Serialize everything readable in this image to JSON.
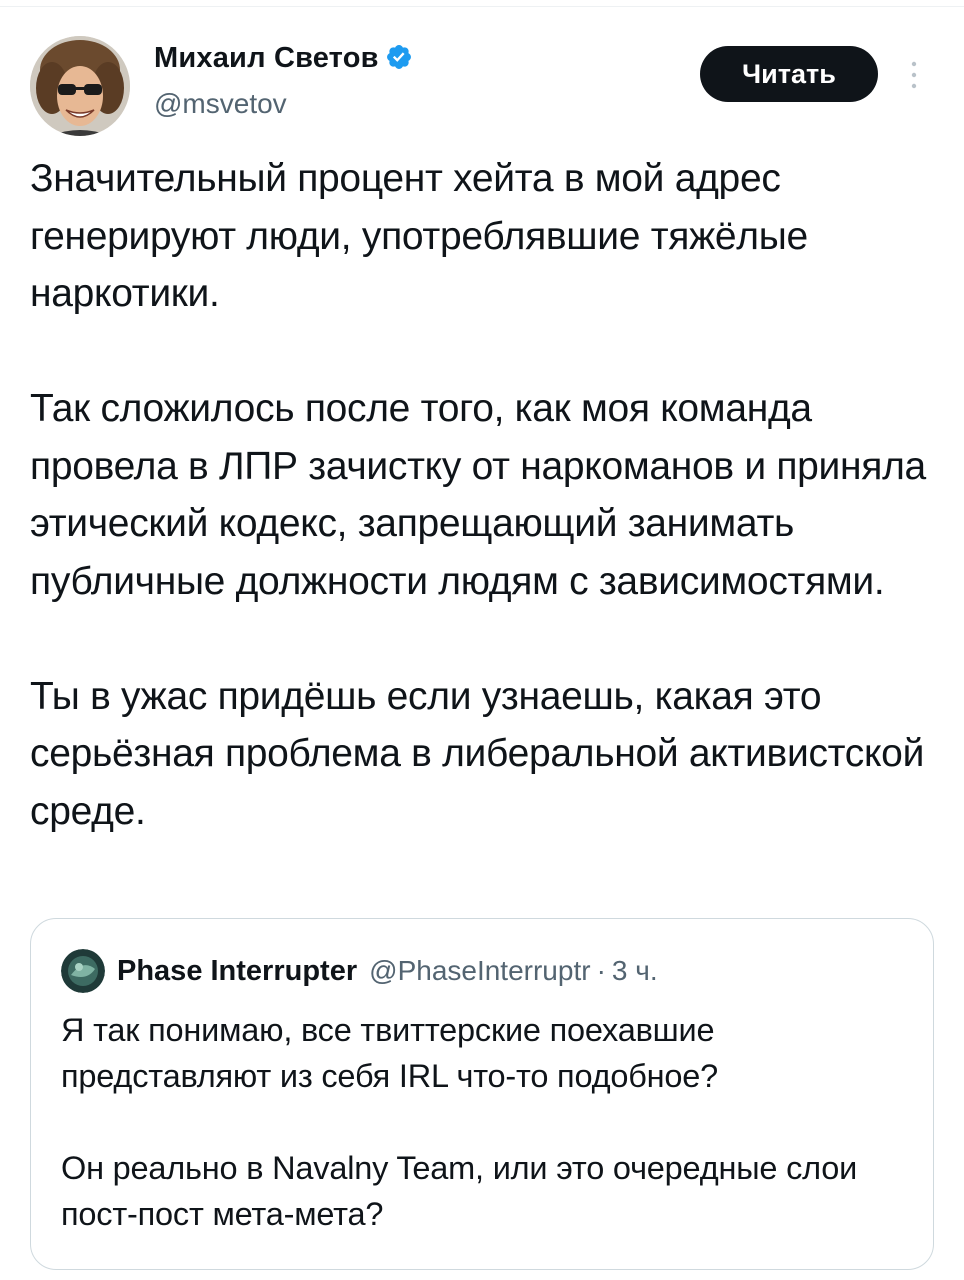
{
  "tweet": {
    "author": {
      "name": "Михаил Светов",
      "handle": "@msvetov",
      "verified": true
    },
    "follow_button_label": "Читать",
    "text": "Значительный процент хейта в мой адрес генерируют люди, употреблявшие тяжёлые наркотики.\n\nТак сложилось после того, как моя команда провела в ЛПР зачистку от наркоманов и приняла этический кодекс, запрещающий занимать публичные должности людям с зависимостями.\n\nТы в ужас придёшь если узнаешь, какая это серьёзная проблема в либеральной активистской среде."
  },
  "quote": {
    "author": {
      "name": "Phase Interrupter",
      "handle": "@PhaseInterruptr"
    },
    "separator": "·",
    "time": "3 ч.",
    "text": "Я так понимаю, все твиттерские поехавшие представляют из себя IRL что-то подобное?\n\nОн реально в Navalny Team, или это очередные слои пост-пост мета-мета?"
  },
  "icons": {
    "verified": "verified-badge-icon",
    "more": "more-vertical-icon"
  },
  "colors": {
    "verified": "#1d9bf0",
    "secondary_text": "#536471",
    "button_bg": "#0f1419",
    "card_border": "#cfd9de"
  }
}
